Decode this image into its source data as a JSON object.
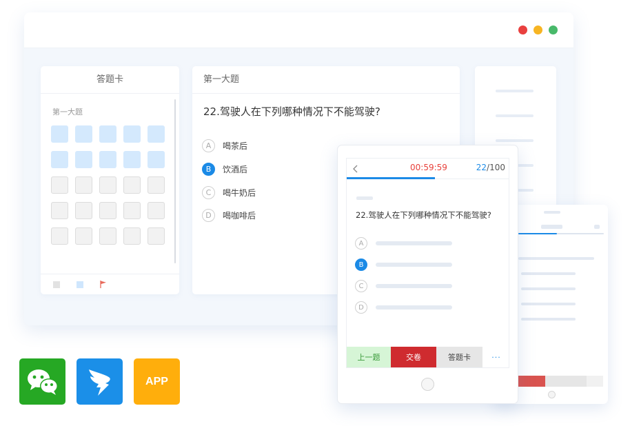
{
  "desktop": {
    "answer_card": {
      "title": "答题卡",
      "section_label": "第一大题",
      "cells": [
        "answered",
        "answered",
        "answered",
        "answered",
        "answered",
        "answered",
        "answered",
        "answered",
        "answered",
        "answered",
        "empty",
        "empty",
        "empty",
        "empty",
        "empty",
        "empty",
        "empty",
        "empty",
        "empty",
        "empty",
        "empty",
        "empty",
        "empty",
        "empty",
        "empty"
      ]
    },
    "question_panel": {
      "section_title": "第一大题",
      "question": "22.驾驶人在下列哪种情况下不能驾驶?",
      "options": [
        {
          "letter": "A",
          "text": "喝茶后",
          "selected": false
        },
        {
          "letter": "B",
          "text": "饮酒后",
          "selected": true
        },
        {
          "letter": "C",
          "text": "喝牛奶后",
          "selected": false
        },
        {
          "letter": "D",
          "text": "喝咖啡后",
          "selected": false
        }
      ]
    }
  },
  "mobile": {
    "timer": "00:59:59",
    "progress_current": "22",
    "progress_total": "/100",
    "progress_fraction": 0.54,
    "question": "22.驾驶人在下列哪种情况下不能驾驶?",
    "options": [
      {
        "letter": "A",
        "selected": false
      },
      {
        "letter": "B",
        "selected": true
      },
      {
        "letter": "C",
        "selected": false
      },
      {
        "letter": "D",
        "selected": false
      }
    ],
    "buttons": {
      "prev": "上一题",
      "submit": "交卷",
      "card": "答题卡",
      "more": "···"
    }
  },
  "platforms": {
    "wechat_icon": "wechat-icon",
    "dingtalk_icon": "dingtalk-icon",
    "app_label": "APP"
  },
  "colors": {
    "accent": "#1b8ae6",
    "timer": "#e8413b",
    "submit": "#cf2b2f",
    "wechat": "#26a824",
    "dingtalk": "#1b8fe8",
    "app": "#ffae0c"
  }
}
